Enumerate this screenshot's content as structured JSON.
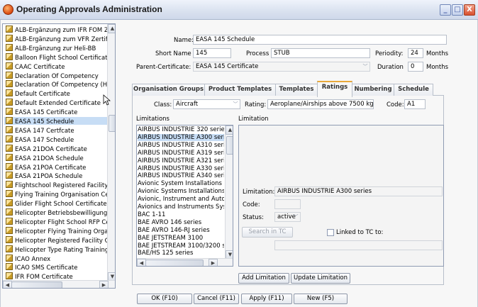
{
  "window": {
    "title": "Operating Approvals Administration",
    "min_glyph": "_",
    "max_glyph": "□",
    "close_glyph": "X"
  },
  "certificates": [
    "ALB-Ergänzung zum IFR FOM Zer",
    "ALB-Ergänzung zum VFR Zertifika",
    "ALB-Ergänzung zur Heli-BB",
    "Balloon Flight School Certificate",
    "CAAC Certificate",
    "Declaration Of Competency",
    "Declaration Of Competency (Heli)",
    "Default Certificate",
    "Default Extended Certificate",
    "EASA 145 Certificate",
    "EASA 145 Schedule",
    "EASA 147 Certfcate",
    "EASA 147 Schedule",
    "EASA 21DOA Certificate",
    "EASA 21DOA Schedule",
    "EASA 21POA Certificate",
    "EASA 21POA Schedule",
    "Flightschool Registered Facility Ce",
    "Flying Training Organisation Certi",
    "Glider Flight School Certificate",
    "Helicopter Betriebsbewilligung",
    "Helicopter Flight School RFP Certi",
    "Helicopter Flying Training Organis",
    "Helicopter Registered Facility Cer",
    "Helicopter Type Rating Training C",
    "ICAO Annex",
    "ICAO SMS Certificate",
    "IFR FOM Certificate"
  ],
  "selected_certificate_index": 10,
  "form": {
    "name_label": "Name:",
    "name_value": "EASA 145 Schedule",
    "short_name_label": "Short Name",
    "short_name_value": "145",
    "process_label": "Process",
    "process_value": "STUB",
    "periodity_label": "Periodity:",
    "periodity_value": "24",
    "periodity_unit": "Months",
    "parent_label": "Parent-Certificate:",
    "parent_value": "EASA 145 Certificate",
    "duration_label": "Duration",
    "duration_value": "0",
    "duration_unit": "Months"
  },
  "tabs": [
    "Organisation Groups",
    "Product Templates",
    "Templates",
    "Ratings",
    "Numbering",
    "Schedule"
  ],
  "active_tab": "Ratings",
  "ratings": {
    "class_label": "Class:",
    "class_value": "Aircraft",
    "rating_label": "Rating:",
    "rating_value": "Aeroplane/Airships above 7500 kg",
    "code_label": "Code:",
    "code_value": "A1",
    "limitations_header": "Limitations",
    "limitation_header": "Limitation",
    "limitations": [
      "AIRBUS INDUSTRIE 320 series",
      "AIRBUS INDUSTRIE A300 serie",
      "AIRBUS INDUSTRIE A310 serie",
      "AIRBUS INDUSTRIE A319 serie",
      "AIRBUS INDUSTRIE A321 serie",
      "AIRBUS INDUSTRIE A330 serie",
      "AIRBUS INDUSTRIE A340 serie",
      "Avionic System Installations",
      "Avionic Systems Installations",
      "Avionic, Instrument and Autopi",
      "Avionics and Instruments Syste",
      "BAC 1-11",
      "BAE AVRO 146 series",
      "BAE AVRO 146-RJ series",
      "BAE JETSTREAM 3100",
      "BAE JETSTREAM 3100/3200 se",
      "BAE/HS 125 series"
    ],
    "selected_limitation_index": 1,
    "detail": {
      "limitation_label": "Limitation:",
      "limitation_value": "AIRBUS INDUSTRIE A300 series",
      "code_label": "Code:",
      "code_value": "",
      "status_label": "Status:",
      "status_value": "active",
      "search_button": "Search in TC",
      "linked_label": "Linked to TC to:",
      "linked_value": ""
    },
    "add_button": "Add Limitation",
    "update_button": "Update Limitation"
  },
  "footer": {
    "ok": "OK (F10)",
    "cancel": "Cancel (F11)",
    "apply": "Apply (F11)",
    "new": "New (F5)"
  }
}
